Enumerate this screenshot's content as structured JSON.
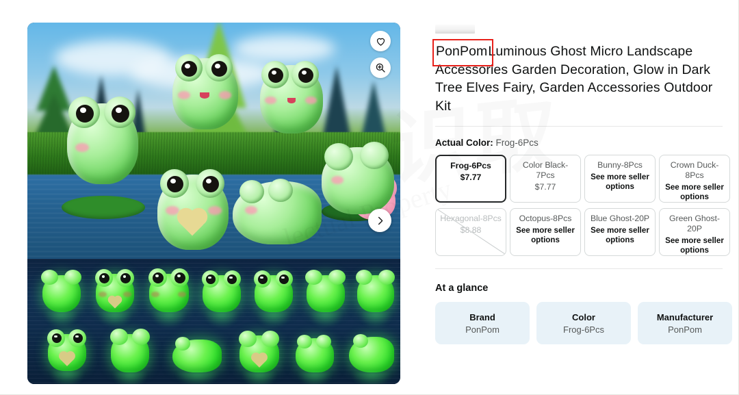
{
  "product": {
    "brand_highlight": "PonPom",
    "title_rest": "Luminous Ghost Micro Landscape Accessories Garden Decoration, Glow in Dark Tree Elves Fairy, Garden Accessories Outdoor Kit"
  },
  "gallery": {
    "favorite_icon": "heart-icon",
    "zoom_icon": "magnifier-plus-icon",
    "next_icon": "chevron-right-icon",
    "top_image_alt": "Green glow-in-the-dark frog figurines on grass beside water with blurred pine trees",
    "bottom_image_alt": "Two rows of glowing green frog figurines on a dark blue reflective surface"
  },
  "variation": {
    "label": "Actual Color:",
    "selected_value": "Frog-6Pcs",
    "see_more_text": "See more seller options",
    "options": [
      {
        "name": "Frog-6Pcs",
        "price": "$7.77",
        "state": "selected"
      },
      {
        "name": "Color Black-7Pcs",
        "price": "$7.77",
        "state": "available"
      },
      {
        "name": "Bunny-8Pcs",
        "price": "",
        "state": "see-more"
      },
      {
        "name": "Crown Duck-8Pcs",
        "price": "",
        "state": "see-more"
      },
      {
        "name": "Hexagonal-8Pcs",
        "price": "$8.88",
        "state": "unavailable"
      },
      {
        "name": "Octopus-8Pcs",
        "price": "",
        "state": "see-more"
      },
      {
        "name": "Blue Ghost-20P",
        "price": "",
        "state": "see-more"
      },
      {
        "name": "Green Ghost-20P",
        "price": "",
        "state": "see-more"
      }
    ]
  },
  "at_a_glance": {
    "heading": "At a glance",
    "cards": [
      {
        "key": "Brand",
        "value": "PonPom"
      },
      {
        "key": "Color",
        "value": "Frog-6Pcs"
      },
      {
        "key": "Manufacturer",
        "value": "PonPom"
      }
    ]
  },
  "watermark": {
    "cn_text": "识取",
    "en_text": "lectual Property"
  },
  "colors": {
    "selected_border": "#232627",
    "annotation_red": "#e8201a",
    "glance_card_bg": "#e8f2f8",
    "muted_text": "#565959"
  }
}
